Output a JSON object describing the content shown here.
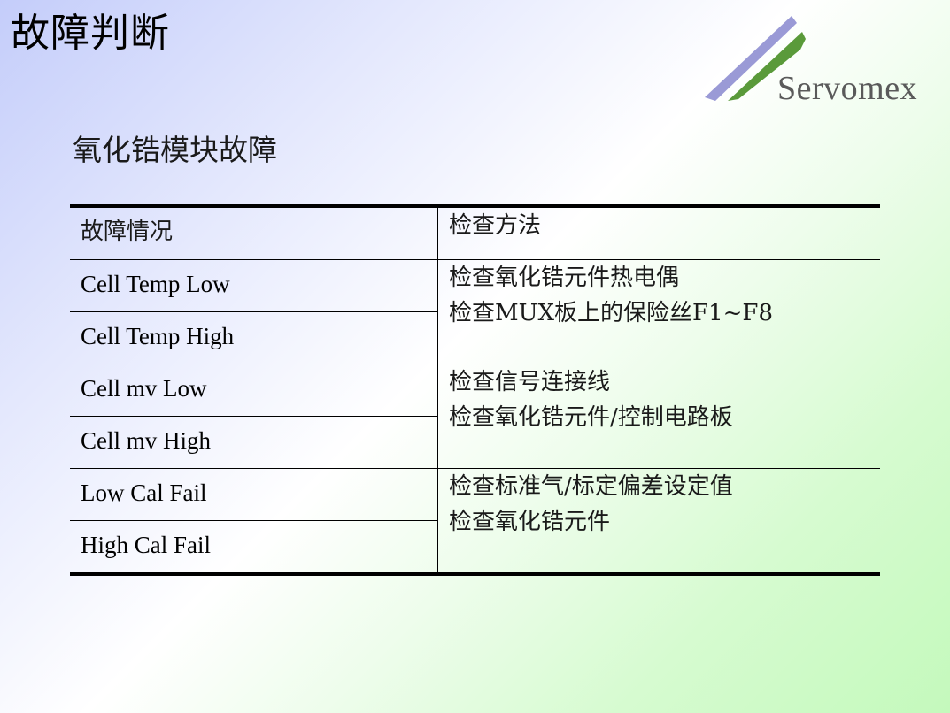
{
  "slide": {
    "title": "故障判断",
    "subtitle": "氧化锆模块故障",
    "logo": {
      "text": "Servomex",
      "stripe_colors": [
        "#9a9ad6",
        "#5a9a3a"
      ]
    }
  },
  "table": {
    "headers": [
      "故障情况",
      "检查方法"
    ],
    "groups": [
      {
        "faults": [
          "Cell Temp Low",
          "Cell Temp High"
        ],
        "methods": [
          "检查氧化锆元件热电偶",
          "检查MUX板上的保险丝F1~F8"
        ]
      },
      {
        "faults": [
          "Cell mv Low",
          "Cell mv High"
        ],
        "methods": [
          "检查信号连接线",
          "检查氧化锆元件/控制电路板"
        ]
      },
      {
        "faults": [
          "Low Cal Fail",
          "High Cal Fail"
        ],
        "methods": [
          "检查标准气/标定偏差设定值",
          "检查氧化锆元件"
        ]
      }
    ]
  }
}
